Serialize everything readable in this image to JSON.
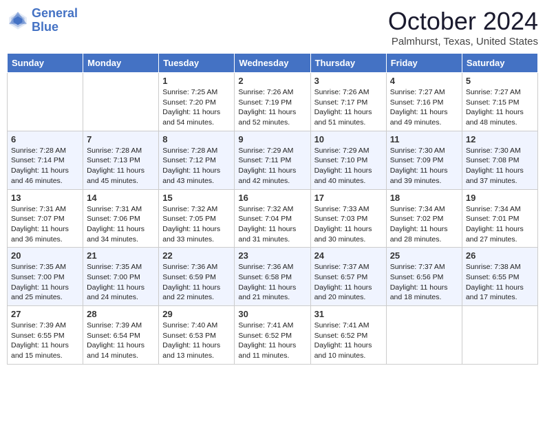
{
  "logo": {
    "line1": "General",
    "line2": "Blue"
  },
  "title": "October 2024",
  "location": "Palmhurst, Texas, United States",
  "weekdays": [
    "Sunday",
    "Monday",
    "Tuesday",
    "Wednesday",
    "Thursday",
    "Friday",
    "Saturday"
  ],
  "weeks": [
    [
      {
        "day": "",
        "sunrise": "",
        "sunset": "",
        "daylight": ""
      },
      {
        "day": "",
        "sunrise": "",
        "sunset": "",
        "daylight": ""
      },
      {
        "day": "1",
        "sunrise": "Sunrise: 7:25 AM",
        "sunset": "Sunset: 7:20 PM",
        "daylight": "Daylight: 11 hours and 54 minutes."
      },
      {
        "day": "2",
        "sunrise": "Sunrise: 7:26 AM",
        "sunset": "Sunset: 7:19 PM",
        "daylight": "Daylight: 11 hours and 52 minutes."
      },
      {
        "day": "3",
        "sunrise": "Sunrise: 7:26 AM",
        "sunset": "Sunset: 7:17 PM",
        "daylight": "Daylight: 11 hours and 51 minutes."
      },
      {
        "day": "4",
        "sunrise": "Sunrise: 7:27 AM",
        "sunset": "Sunset: 7:16 PM",
        "daylight": "Daylight: 11 hours and 49 minutes."
      },
      {
        "day": "5",
        "sunrise": "Sunrise: 7:27 AM",
        "sunset": "Sunset: 7:15 PM",
        "daylight": "Daylight: 11 hours and 48 minutes."
      }
    ],
    [
      {
        "day": "6",
        "sunrise": "Sunrise: 7:28 AM",
        "sunset": "Sunset: 7:14 PM",
        "daylight": "Daylight: 11 hours and 46 minutes."
      },
      {
        "day": "7",
        "sunrise": "Sunrise: 7:28 AM",
        "sunset": "Sunset: 7:13 PM",
        "daylight": "Daylight: 11 hours and 45 minutes."
      },
      {
        "day": "8",
        "sunrise": "Sunrise: 7:28 AM",
        "sunset": "Sunset: 7:12 PM",
        "daylight": "Daylight: 11 hours and 43 minutes."
      },
      {
        "day": "9",
        "sunrise": "Sunrise: 7:29 AM",
        "sunset": "Sunset: 7:11 PM",
        "daylight": "Daylight: 11 hours and 42 minutes."
      },
      {
        "day": "10",
        "sunrise": "Sunrise: 7:29 AM",
        "sunset": "Sunset: 7:10 PM",
        "daylight": "Daylight: 11 hours and 40 minutes."
      },
      {
        "day": "11",
        "sunrise": "Sunrise: 7:30 AM",
        "sunset": "Sunset: 7:09 PM",
        "daylight": "Daylight: 11 hours and 39 minutes."
      },
      {
        "day": "12",
        "sunrise": "Sunrise: 7:30 AM",
        "sunset": "Sunset: 7:08 PM",
        "daylight": "Daylight: 11 hours and 37 minutes."
      }
    ],
    [
      {
        "day": "13",
        "sunrise": "Sunrise: 7:31 AM",
        "sunset": "Sunset: 7:07 PM",
        "daylight": "Daylight: 11 hours and 36 minutes."
      },
      {
        "day": "14",
        "sunrise": "Sunrise: 7:31 AM",
        "sunset": "Sunset: 7:06 PM",
        "daylight": "Daylight: 11 hours and 34 minutes."
      },
      {
        "day": "15",
        "sunrise": "Sunrise: 7:32 AM",
        "sunset": "Sunset: 7:05 PM",
        "daylight": "Daylight: 11 hours and 33 minutes."
      },
      {
        "day": "16",
        "sunrise": "Sunrise: 7:32 AM",
        "sunset": "Sunset: 7:04 PM",
        "daylight": "Daylight: 11 hours and 31 minutes."
      },
      {
        "day": "17",
        "sunrise": "Sunrise: 7:33 AM",
        "sunset": "Sunset: 7:03 PM",
        "daylight": "Daylight: 11 hours and 30 minutes."
      },
      {
        "day": "18",
        "sunrise": "Sunrise: 7:34 AM",
        "sunset": "Sunset: 7:02 PM",
        "daylight": "Daylight: 11 hours and 28 minutes."
      },
      {
        "day": "19",
        "sunrise": "Sunrise: 7:34 AM",
        "sunset": "Sunset: 7:01 PM",
        "daylight": "Daylight: 11 hours and 27 minutes."
      }
    ],
    [
      {
        "day": "20",
        "sunrise": "Sunrise: 7:35 AM",
        "sunset": "Sunset: 7:00 PM",
        "daylight": "Daylight: 11 hours and 25 minutes."
      },
      {
        "day": "21",
        "sunrise": "Sunrise: 7:35 AM",
        "sunset": "Sunset: 7:00 PM",
        "daylight": "Daylight: 11 hours and 24 minutes."
      },
      {
        "day": "22",
        "sunrise": "Sunrise: 7:36 AM",
        "sunset": "Sunset: 6:59 PM",
        "daylight": "Daylight: 11 hours and 22 minutes."
      },
      {
        "day": "23",
        "sunrise": "Sunrise: 7:36 AM",
        "sunset": "Sunset: 6:58 PM",
        "daylight": "Daylight: 11 hours and 21 minutes."
      },
      {
        "day": "24",
        "sunrise": "Sunrise: 7:37 AM",
        "sunset": "Sunset: 6:57 PM",
        "daylight": "Daylight: 11 hours and 20 minutes."
      },
      {
        "day": "25",
        "sunrise": "Sunrise: 7:37 AM",
        "sunset": "Sunset: 6:56 PM",
        "daylight": "Daylight: 11 hours and 18 minutes."
      },
      {
        "day": "26",
        "sunrise": "Sunrise: 7:38 AM",
        "sunset": "Sunset: 6:55 PM",
        "daylight": "Daylight: 11 hours and 17 minutes."
      }
    ],
    [
      {
        "day": "27",
        "sunrise": "Sunrise: 7:39 AM",
        "sunset": "Sunset: 6:55 PM",
        "daylight": "Daylight: 11 hours and 15 minutes."
      },
      {
        "day": "28",
        "sunrise": "Sunrise: 7:39 AM",
        "sunset": "Sunset: 6:54 PM",
        "daylight": "Daylight: 11 hours and 14 minutes."
      },
      {
        "day": "29",
        "sunrise": "Sunrise: 7:40 AM",
        "sunset": "Sunset: 6:53 PM",
        "daylight": "Daylight: 11 hours and 13 minutes."
      },
      {
        "day": "30",
        "sunrise": "Sunrise: 7:41 AM",
        "sunset": "Sunset: 6:52 PM",
        "daylight": "Daylight: 11 hours and 11 minutes."
      },
      {
        "day": "31",
        "sunrise": "Sunrise: 7:41 AM",
        "sunset": "Sunset: 6:52 PM",
        "daylight": "Daylight: 11 hours and 10 minutes."
      },
      {
        "day": "",
        "sunrise": "",
        "sunset": "",
        "daylight": ""
      },
      {
        "day": "",
        "sunrise": "",
        "sunset": "",
        "daylight": ""
      }
    ]
  ]
}
